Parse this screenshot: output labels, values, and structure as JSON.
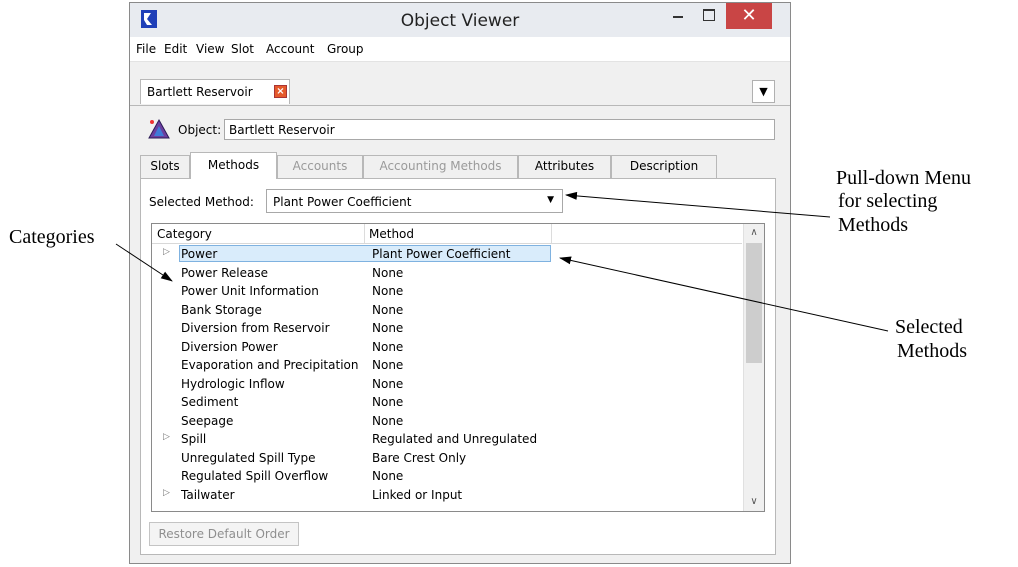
{
  "window": {
    "title": "Object Viewer"
  },
  "menu": [
    "File",
    "Edit",
    "View",
    "Slot",
    "Account",
    "Group"
  ],
  "doc_tab": {
    "label": "Bartlett Reservoir",
    "close": "×",
    "menu_arrow": "▼"
  },
  "object": {
    "label": "Object:",
    "value": "Bartlett Reservoir"
  },
  "tabs": [
    {
      "label": "Slots"
    },
    {
      "label": "Methods"
    },
    {
      "label": "Accounts"
    },
    {
      "label": "Accounting Methods"
    },
    {
      "label": "Attributes"
    },
    {
      "label": "Description"
    }
  ],
  "selected_method": {
    "label": "Selected Method:",
    "value": "Plant Power Coefficient"
  },
  "table": {
    "headers": {
      "category": "Category",
      "method": "Method"
    },
    "rows": [
      {
        "category": "Power",
        "method": "Plant Power Coefficient",
        "expandable": "▷"
      },
      {
        "category": "Power Release",
        "method": "None"
      },
      {
        "category": "Power Unit Information",
        "method": "None"
      },
      {
        "category": "Bank Storage",
        "method": "None"
      },
      {
        "category": "Diversion from Reservoir",
        "method": "None"
      },
      {
        "category": "Diversion Power",
        "method": "None"
      },
      {
        "category": "Evaporation and Precipitation",
        "method": "None"
      },
      {
        "category": "Hydrologic Inflow",
        "method": "None"
      },
      {
        "category": "Sediment",
        "method": "None"
      },
      {
        "category": "Seepage",
        "method": "None"
      },
      {
        "category": "Spill",
        "method": "Regulated and Unregulated",
        "expandable": "▷"
      },
      {
        "category": "Unregulated Spill Type",
        "method": "Bare Crest Only"
      },
      {
        "category": "Regulated Spill Overflow",
        "method": "None"
      },
      {
        "category": "Tailwater",
        "method": "Linked or Input",
        "expandable": "▷"
      }
    ]
  },
  "restore_button": "Restore Default Order",
  "annotations": {
    "categories": "Categories",
    "pulldown_line1": "Pull-down Menu",
    "pulldown_line2": "for selecting",
    "pulldown_line3": "Methods",
    "selected_line1": "Selected",
    "selected_line2": "Methods"
  },
  "colors": {
    "close_button": "#c94545",
    "selection": "#d9ecfb",
    "selection_border": "#7fb2e0",
    "app_icon": "#1f3fb8"
  }
}
